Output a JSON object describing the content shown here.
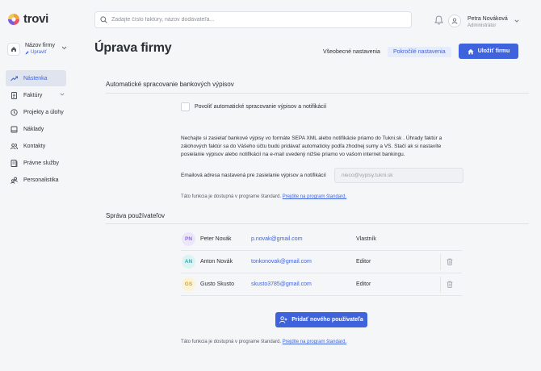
{
  "app": {
    "logo_text": "trovi"
  },
  "company": {
    "name": "Názov firmy",
    "edit_label": "Upraviť"
  },
  "nav": {
    "items": [
      {
        "label": "Nástenka",
        "icon": "trend-icon",
        "active": true
      },
      {
        "label": "Faktúry",
        "icon": "document-icon",
        "has_caret": true
      },
      {
        "label": "Projekty a úlohy",
        "icon": "clock-icon"
      },
      {
        "label": "Náklady",
        "icon": "book-icon"
      },
      {
        "label": "Kontakty",
        "icon": "users-icon"
      },
      {
        "label": "Právne služby",
        "icon": "file-icon"
      },
      {
        "label": "Personalistika",
        "icon": "people-icon"
      }
    ]
  },
  "search": {
    "placeholder": "Zadajte číslo faktúry, názov dodávateľa..."
  },
  "user": {
    "name": "Petra Nováková",
    "role": "Administrátor"
  },
  "page": {
    "title": "Úprava firmy",
    "tabs": [
      "Všeobecné nastavenia",
      "Pokročilé nastavenia"
    ],
    "active_tab": "Pokročilé nastavenia",
    "save_label": "Uložiť firmu"
  },
  "bank": {
    "title": "Automatické spracovanie bankových výpisov",
    "checkbox_label": "Povoliť automatické spracovanie výpisov a notifikácií",
    "checked": false,
    "description": "Nechajte si zasielať bankové výpisy vo formáte SEPA XML alebo notifikácie priamo do Tukni.sk . Úhrady faktúr a zálohových faktúr sa do Vášeho účtu budú pridávať automaticky podľa zhodnej sumy a VS. Stačí ak si nastavíte posielanie výpisov alebo notifikácií na e-mail uvedený nižšie priamo vo vašom internet bankingu.",
    "email_label": "Emailová adresa nastavená pre zasielanie výpisov a notifikácií",
    "email_placeholder": "nieco@vypisy.tukni.sk",
    "note": "Táto funkcia je dostupná v programe štandard.",
    "note_link": "Prejdite na program štandard."
  },
  "users": {
    "title": "Správa používateľov",
    "rows": [
      {
        "initials": "PN",
        "name": "Peter Novák",
        "email": "p.novak@gmail.com",
        "role": "Vlastník",
        "badge_bg": "#ece6fb",
        "badge_fg": "#8b6fd6",
        "deletable": false
      },
      {
        "initials": "AN",
        "name": "Anton Novák",
        "email": "tonkonovak@gmail.com",
        "role": "Editor",
        "badge_bg": "#dcf3f4",
        "badge_fg": "#3aa9b3",
        "deletable": true
      },
      {
        "initials": "GS",
        "name": "Gusto Skusto",
        "email": "skusto3785@gmail.com",
        "role": "Editor",
        "badge_bg": "#fcf2d6",
        "badge_fg": "#d6a62a",
        "deletable": true
      }
    ],
    "add_label": "Pridať nového používateľa",
    "note": "Táto funkcia je dostupná v programe štandard.",
    "note_link": "Prejdite na program štandard."
  },
  "colors": {
    "accent": "#3e63dd",
    "active_nav_bg": "#dfe4ee"
  }
}
